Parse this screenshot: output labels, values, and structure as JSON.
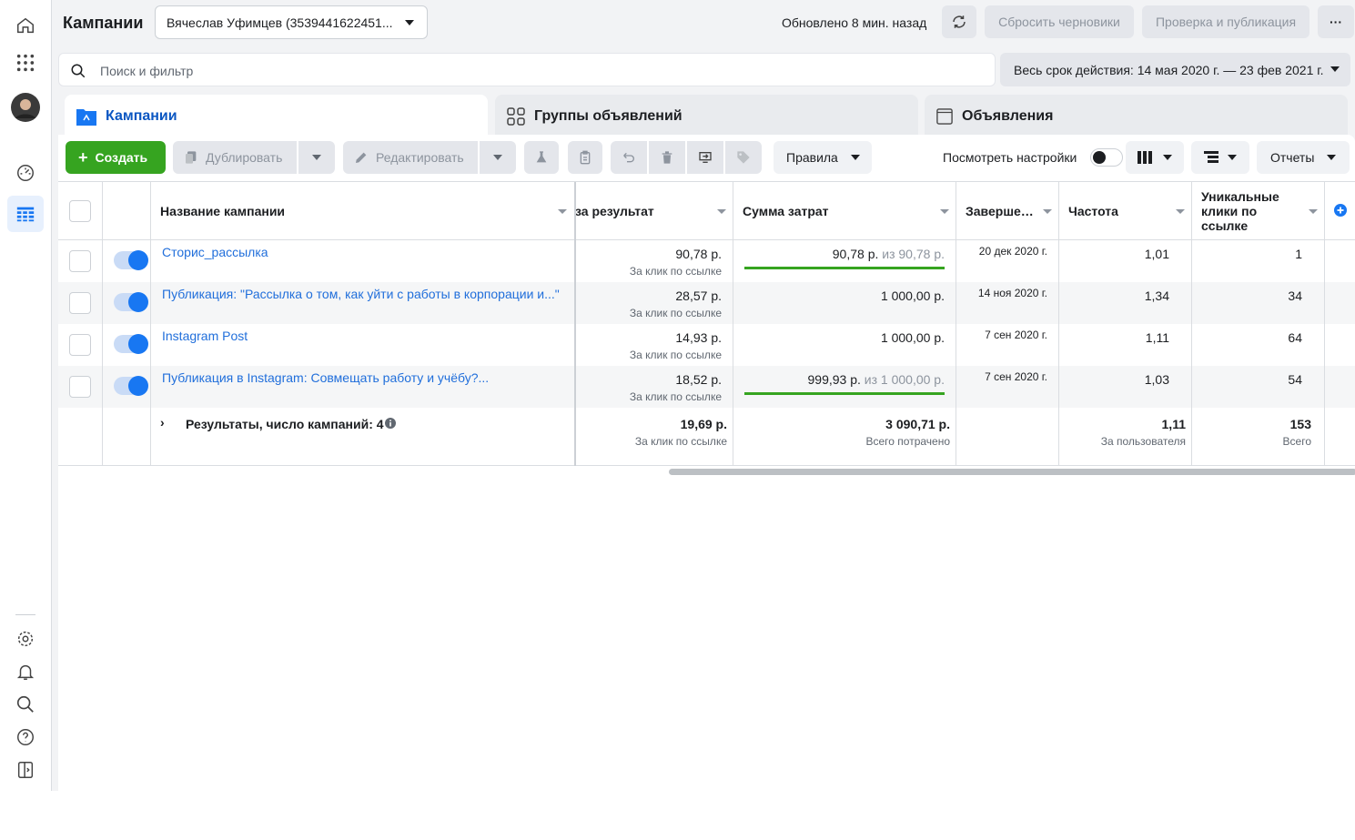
{
  "header": {
    "title": "Кампании",
    "account": "Вячеслав Уфимцев (3539441622451...",
    "updated": "Обновлено 8 мин. назад",
    "discard": "Сбросить черновики",
    "review": "Проверка и публикация",
    "more": "···"
  },
  "search": {
    "placeholder": "Поиск и фильтр",
    "date_range": "Весь срок действия: 14 мая 2020 г. — 23 фев 2021 г."
  },
  "tabs": {
    "campaigns": "Кампании",
    "adsets": "Группы объявлений",
    "ads": "Объявления"
  },
  "toolbar": {
    "create": "Создать",
    "duplicate": "Дублировать",
    "edit": "Редактировать",
    "rules": "Правила",
    "view_settings": "Посмотреть настройки",
    "reports": "Отчеты"
  },
  "columns": {
    "name": "Название кампании",
    "cost": "за результат",
    "spend": "Сумма затрат",
    "end": "Заверше…",
    "freq": "Частота",
    "clicks": "Уникальные клики по ссылке"
  },
  "rows": [
    {
      "name": "Сторис_рассылка",
      "cost": "90,78 р.",
      "cost_sub": "За клик по ссылке",
      "spend": "90,78 р.",
      "spend_of": "из 90,78 р.",
      "end": "20 дек 2020 г.",
      "freq": "1,01",
      "clicks": "1"
    },
    {
      "name": "Публикация: \"Рассылка о том, как уйти с работы в корпорации и...\"",
      "cost": "28,57 р.",
      "cost_sub": "За клик по ссылке",
      "spend": "1 000,00 р.",
      "spend_of": "",
      "end": "14 ноя 2020 г.",
      "freq": "1,34",
      "clicks": "34"
    },
    {
      "name": "Instagram Post",
      "cost": "14,93 р.",
      "cost_sub": "За клик по ссылке",
      "spend": "1 000,00 р.",
      "spend_of": "",
      "end": "7 сен 2020 г.",
      "freq": "1,11",
      "clicks": "64"
    },
    {
      "name": "Публикация в Instagram: Совмещать работу и учёбу?...",
      "cost": "18,52 р.",
      "cost_sub": "За клик по ссылке",
      "spend": "999,93 р.",
      "spend_of": "из 1 000,00 р.",
      "end": "7 сен 2020 г.",
      "freq": "1,03",
      "clicks": "54"
    }
  ],
  "totals": {
    "label": "Результаты, число кампаний: 4",
    "cost": "19,69 р.",
    "cost_sub": "За клик по ссылке",
    "spend": "3 090,71 р.",
    "spend_sub": "Всего потрачено",
    "freq": "1,11",
    "freq_sub": "За пользователя",
    "clicks": "153",
    "clicks_sub": "Всего"
  },
  "colors": {
    "accent": "#1877f2",
    "link": "#216fdb",
    "green": "#36a420"
  }
}
